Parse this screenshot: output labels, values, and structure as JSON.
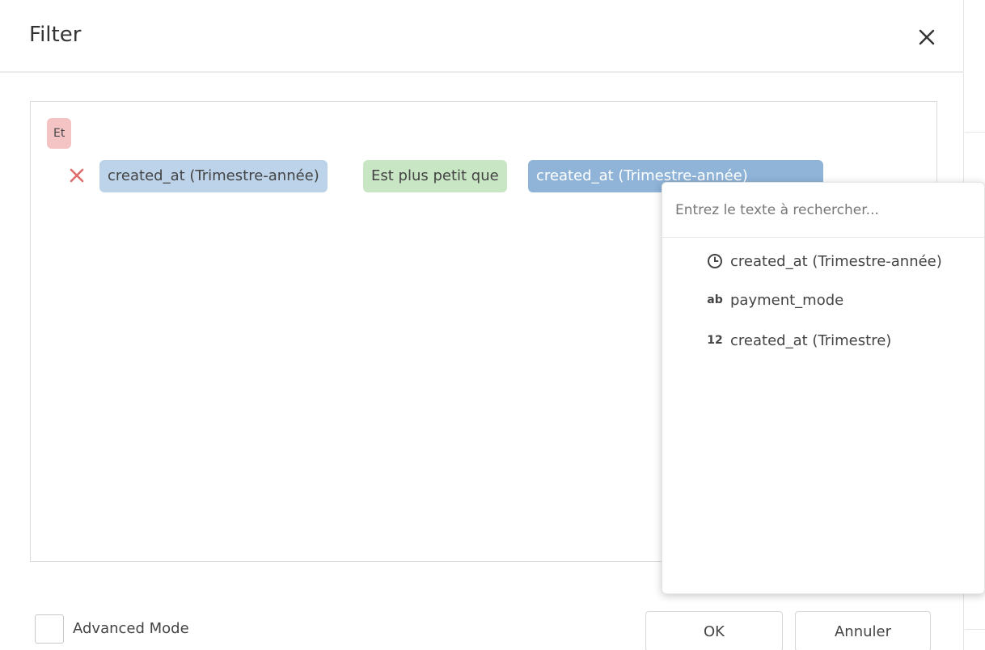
{
  "dialog": {
    "title": "Filter",
    "close_icon": "close-icon"
  },
  "filter": {
    "group_operator": "Et",
    "condition": {
      "remove_icon": "close-icon",
      "field": "created_at (Trimestre-année)",
      "operator": "Est plus petit que",
      "value": "created_at (Trimestre-année)"
    }
  },
  "dropdown": {
    "search_placeholder": "Entrez le texte à rechercher...",
    "search_value": "",
    "items": [
      {
        "icon": "clock-icon",
        "icon_text": "",
        "label": "created_at (Trimestre-année)"
      },
      {
        "icon": "text-type-icon",
        "icon_text": "ab",
        "label": "payment_mode"
      },
      {
        "icon": "number-type-icon",
        "icon_text": "12",
        "label": "created_at (Trimestre)"
      }
    ]
  },
  "footer": {
    "advanced_mode_label": "Advanced Mode",
    "advanced_mode_checked": false,
    "ok_label": "OK",
    "cancel_label": "Annuler"
  },
  "colors": {
    "group_tag": "#f4c4c4",
    "field_tag": "#bcd3ea",
    "operator_tag": "#c8e6c4",
    "value_tag": "#8fb4d8",
    "remove_x": "#e06b6b"
  }
}
